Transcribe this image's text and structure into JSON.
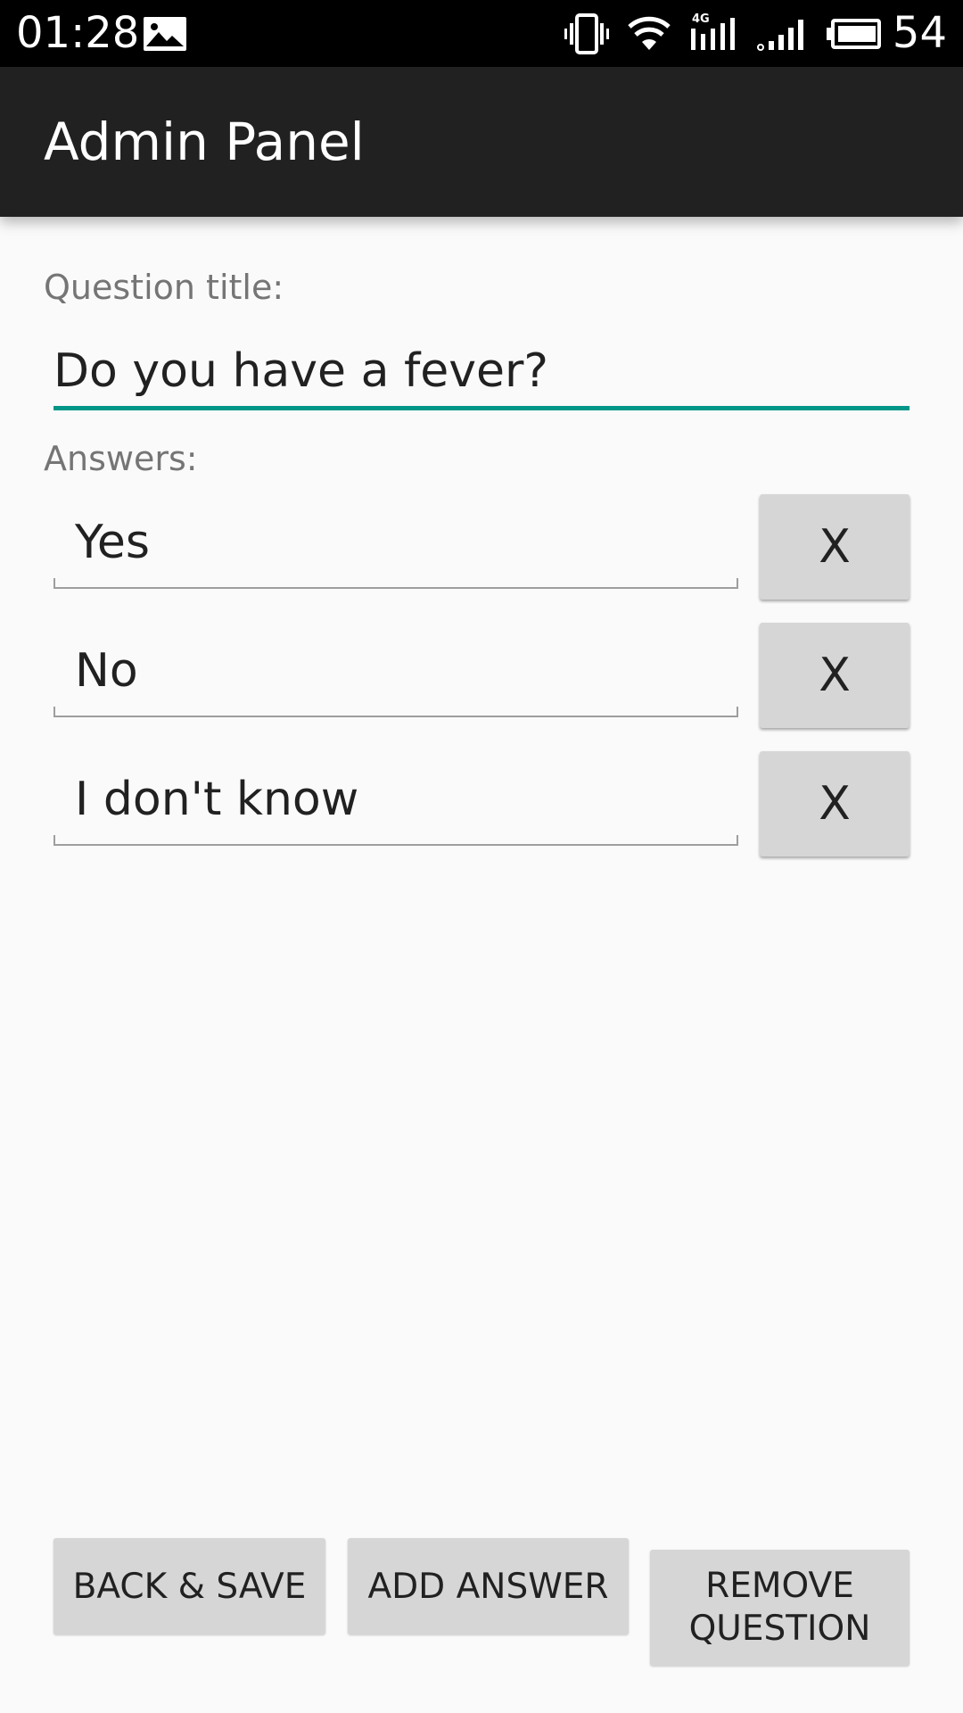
{
  "status_bar": {
    "time": "01:28",
    "battery_level": "54",
    "icons": [
      "image-icon",
      "vibrate-icon",
      "wifi-icon",
      "4g-signal-icon",
      "signal-icon",
      "battery-icon"
    ]
  },
  "app_bar": {
    "title": "Admin Panel"
  },
  "form": {
    "question_label": "Question title:",
    "question_value": "Do you have a fever?",
    "answers_label": "Answers:",
    "answers": [
      {
        "value": "Yes",
        "remove_label": "X"
      },
      {
        "value": "No",
        "remove_label": "X"
      },
      {
        "value": "I don't know",
        "remove_label": "X"
      }
    ]
  },
  "actions": {
    "back_save": "BACK & SAVE",
    "add_answer": "ADD ANSWER",
    "remove_question_line1": "REMOVE",
    "remove_question_line2": "QUESTION"
  },
  "colors": {
    "status_bar": "#000000",
    "app_bar": "#212121",
    "background": "#fafafa",
    "accent": "#009688",
    "button": "#d6d6d6"
  }
}
